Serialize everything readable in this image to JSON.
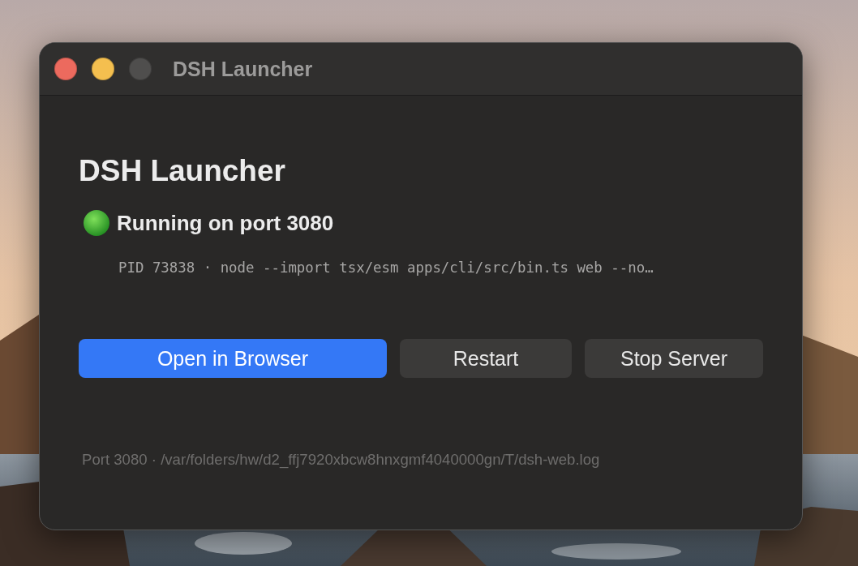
{
  "window": {
    "title": "DSH Launcher",
    "controls": [
      {
        "kind": "close",
        "disabled": false
      },
      {
        "kind": "minimize",
        "disabled": false
      },
      {
        "kind": "zoom",
        "disabled": true
      }
    ]
  },
  "heading": "DSH Launcher",
  "status": {
    "text": "Running on port 3080",
    "detail": "PID 73838 · node --import tsx/esm apps/cli/src/bin.ts web --no…"
  },
  "buttons": [
    {
      "label": "Open in Browser",
      "kind": "primary"
    },
    {
      "label": "Restart",
      "kind": "secondary"
    },
    {
      "label": "Stop Server",
      "kind": "secondary"
    }
  ],
  "footer": "Port 3080 · /var/folders/hw/d2_ffj7920xbcw8hnxgmf4040000gn/T/dsh-web.log"
}
